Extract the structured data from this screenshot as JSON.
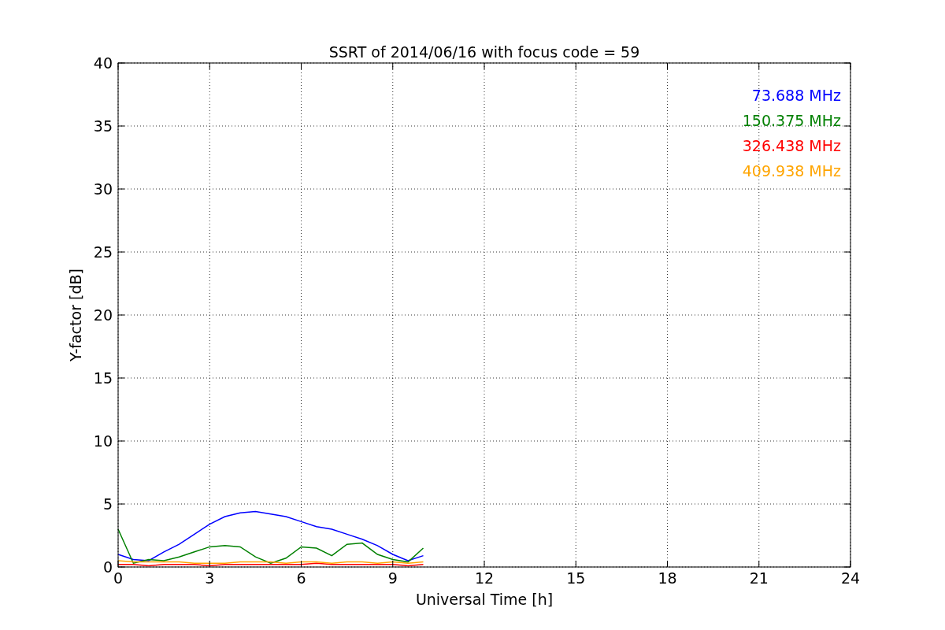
{
  "chart_data": {
    "type": "line",
    "title": "SSRT of 2014/06/16 with focus code = 59",
    "xlabel": "Universal Time [h]",
    "ylabel": "Y-factor [dB]",
    "x": [
      0,
      0.5,
      1,
      1.5,
      2,
      2.5,
      3,
      3.5,
      4,
      4.5,
      5,
      5.5,
      6,
      6.5,
      7,
      7.5,
      8,
      8.5,
      9,
      9.5,
      10
    ],
    "series": [
      {
        "name": "73.688 MHz",
        "color": "#0000ff",
        "values": [
          1.0,
          0.6,
          0.5,
          1.2,
          1.8,
          2.6,
          3.4,
          4.0,
          4.3,
          4.4,
          4.2,
          4.0,
          3.6,
          3.2,
          3.0,
          2.6,
          2.2,
          1.7,
          1.0,
          0.5,
          0.9
        ]
      },
      {
        "name": "150.375 MHz",
        "color": "#008000",
        "values": [
          3.0,
          0.3,
          0.6,
          0.5,
          0.8,
          1.2,
          1.6,
          1.7,
          1.6,
          0.8,
          0.3,
          0.7,
          1.6,
          1.5,
          0.9,
          1.8,
          1.9,
          1.0,
          0.6,
          0.4,
          1.5
        ]
      },
      {
        "name": "326.438 MHz",
        "color": "#ff0000",
        "values": [
          0.2,
          0.2,
          0.1,
          0.2,
          0.2,
          0.2,
          0.1,
          0.2,
          0.2,
          0.2,
          0.2,
          0.2,
          0.2,
          0.3,
          0.2,
          0.2,
          0.2,
          0.2,
          0.2,
          0.1,
          0.2
        ]
      },
      {
        "name": "409.938 MHz",
        "color": "#ffa500",
        "values": [
          0.5,
          0.4,
          0.4,
          0.4,
          0.4,
          0.3,
          0.3,
          0.3,
          0.4,
          0.4,
          0.4,
          0.3,
          0.4,
          0.4,
          0.3,
          0.4,
          0.4,
          0.3,
          0.4,
          0.3,
          0.4
        ]
      }
    ],
    "grid": true,
    "xlim": [
      0,
      24
    ],
    "ylim": [
      0,
      40
    ],
    "xticks": [
      0,
      3,
      6,
      9,
      12,
      15,
      18,
      21,
      24
    ],
    "yticks": [
      0,
      5,
      10,
      15,
      20,
      25,
      30,
      35,
      40
    ]
  }
}
